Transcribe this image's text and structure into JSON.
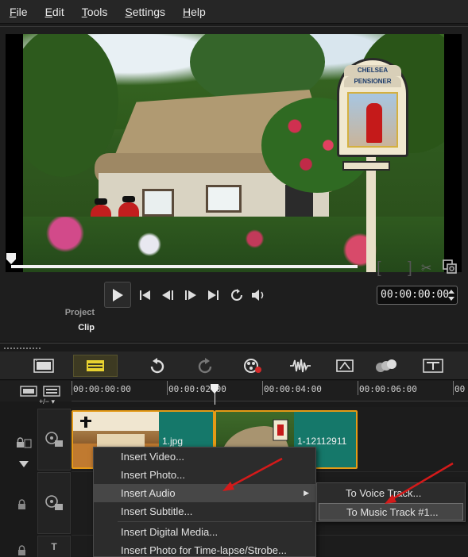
{
  "menubar": {
    "items": [
      "File",
      "Edit",
      "Tools",
      "Settings",
      "Help"
    ]
  },
  "player": {
    "mode_labels": {
      "project": "Project",
      "clip": "Clip"
    },
    "timecode": "00:00:00:00",
    "sign_text": [
      "CHELSEA",
      "PENSIONER"
    ]
  },
  "timeline": {
    "ruler": [
      "00:00:00:00",
      "00:00:02:00",
      "00:00:04:00",
      "00:00:06:00",
      "00"
    ],
    "clips": [
      {
        "label": "1.jpg"
      },
      {
        "label": "1-12112911"
      }
    ],
    "track_controls": "+/− ▾"
  },
  "context_menu": {
    "items": [
      "Insert Video...",
      "Insert Photo...",
      "Insert Audio",
      "Insert Subtitle...",
      "Insert Digital Media...",
      "Insert Photo for Time-lapse/Strobe..."
    ],
    "highlighted": "Insert Audio",
    "submenu": [
      "To Voice Track...",
      "To Music Track #1..."
    ],
    "submenu_highlighted": "To Music Track #1..."
  },
  "colors": {
    "clip_border": "#e59a16",
    "clip_fill": "#15786a",
    "annotation_arrow": "#d41a1a",
    "selected_tool": "#e8d230"
  }
}
